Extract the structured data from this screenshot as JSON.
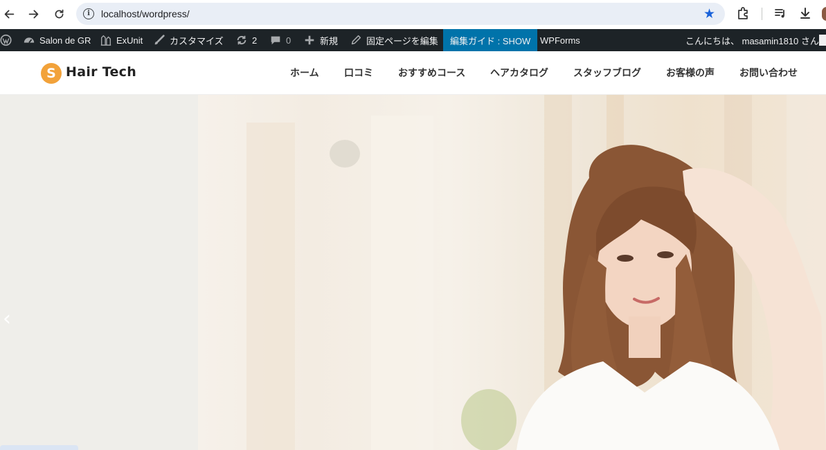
{
  "browser": {
    "url": "localhost/wordpress/"
  },
  "admin_bar": {
    "site_name": "Salon de GR",
    "exunit": "ExUnit",
    "customize": "カスタマイズ",
    "updates_count": "2",
    "comments_count": "0",
    "new_label": "新規",
    "edit_page": "固定ページを編集",
    "edit_guide": "編集ガイド : SHOW",
    "wpforms": "WPForms",
    "greeting": "こんにちは、 masamin1810 さん"
  },
  "site": {
    "logo_letter": "S",
    "logo_text": "Hair Tech",
    "nav": [
      "ホーム",
      "口コミ",
      "おすすめコース",
      "ヘアカタログ",
      "スタッフブログ",
      "お客様の声",
      "お問い合わせ"
    ]
  },
  "hero": {
    "prev_glyph": "‹"
  },
  "colors": {
    "admin_bar": "#1d2327",
    "guide_highlight": "#0073aa",
    "logo_accent": "#f2a23a",
    "bookmark_star": "#1a62d9"
  }
}
